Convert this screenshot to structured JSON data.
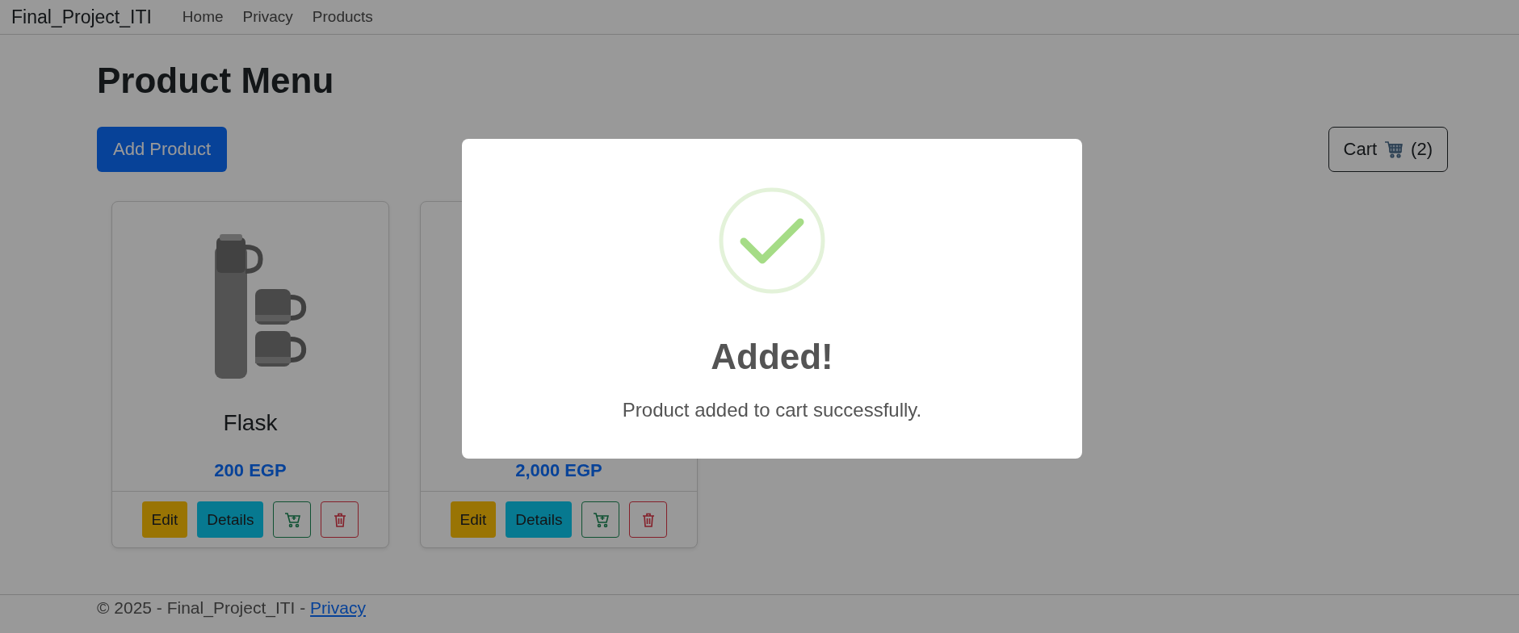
{
  "navbar": {
    "brand": "Final_Project_ITI",
    "links": [
      "Home",
      "Privacy",
      "Products"
    ]
  },
  "page": {
    "title": "Product Menu",
    "add_button": "Add Product",
    "cart_button": {
      "label": "Cart",
      "count": "(2)"
    }
  },
  "products": [
    {
      "name": "Flask",
      "price": "200 EGP",
      "actions": [
        {
          "kind": "edit",
          "label": "Edit"
        },
        {
          "kind": "details",
          "label": "Details"
        },
        {
          "kind": "add-to-cart"
        },
        {
          "kind": "delete"
        }
      ]
    },
    {
      "price": "2,000 EGP",
      "actions": [
        {
          "kind": "edit",
          "label": "Edit"
        },
        {
          "kind": "details",
          "label": "Details"
        },
        {
          "kind": "add-to-cart"
        },
        {
          "kind": "delete"
        }
      ]
    }
  ],
  "footer": {
    "text": "© 2025 - Final_Project_ITI - ",
    "link": "Privacy"
  },
  "dialog": {
    "kind": "success",
    "title": "Added!",
    "message": "Product added to cart successfully."
  }
}
